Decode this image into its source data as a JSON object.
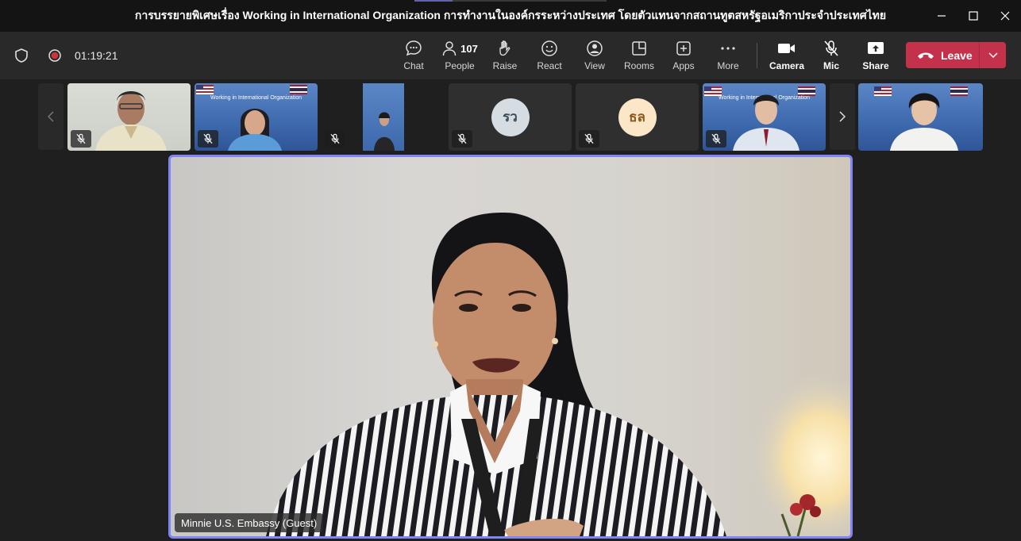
{
  "window": {
    "title": "การบรรยายพิเศษเรื่อง Working in International Organization การทำงานในองค์กรระหว่างประเทศ โดยตัวแทนจากสถานทูตสหรัฐอเมริกาประจำประเทศไทย"
  },
  "meeting": {
    "timer": "01:19:21"
  },
  "toolbar": {
    "chat": "Chat",
    "people": "People",
    "people_count": "107",
    "raise": "Raise",
    "react": "React",
    "view": "View",
    "rooms": "Rooms",
    "apps": "Apps",
    "more": "More",
    "camera": "Camera",
    "mic": "Mic",
    "share": "Share",
    "leave": "Leave"
  },
  "participants": [
    {
      "type": "video"
    },
    {
      "type": "slide",
      "slide_text": "Working in International Organization"
    },
    {
      "type": "video"
    },
    {
      "type": "avatar",
      "initials": "รว"
    },
    {
      "type": "avatar",
      "initials": "ธล"
    },
    {
      "type": "slide",
      "slide_text": "Working in International Organization"
    },
    {
      "type": "video"
    }
  ],
  "stage": {
    "speaker_name": "Minnie U.S. Embassy (Guest)"
  },
  "colors": {
    "accent": "#7f85f5",
    "leave": "#c4314b",
    "record": "#d13438"
  }
}
